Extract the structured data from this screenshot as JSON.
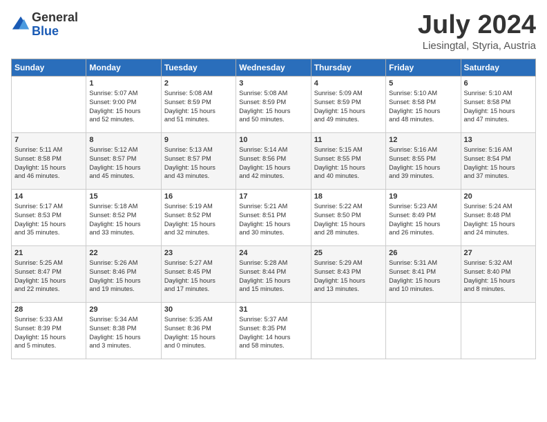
{
  "header": {
    "logo_line1": "General",
    "logo_line2": "Blue",
    "month": "July 2024",
    "location": "Liesingtal, Styria, Austria"
  },
  "weekdays": [
    "Sunday",
    "Monday",
    "Tuesday",
    "Wednesday",
    "Thursday",
    "Friday",
    "Saturday"
  ],
  "weeks": [
    [
      {
        "day": "",
        "sunrise": "",
        "sunset": "",
        "daylight": ""
      },
      {
        "day": "1",
        "sunrise": "Sunrise: 5:07 AM",
        "sunset": "Sunset: 9:00 PM",
        "daylight": "Daylight: 15 hours and 52 minutes."
      },
      {
        "day": "2",
        "sunrise": "Sunrise: 5:08 AM",
        "sunset": "Sunset: 8:59 PM",
        "daylight": "Daylight: 15 hours and 51 minutes."
      },
      {
        "day": "3",
        "sunrise": "Sunrise: 5:08 AM",
        "sunset": "Sunset: 8:59 PM",
        "daylight": "Daylight: 15 hours and 50 minutes."
      },
      {
        "day": "4",
        "sunrise": "Sunrise: 5:09 AM",
        "sunset": "Sunset: 8:59 PM",
        "daylight": "Daylight: 15 hours and 49 minutes."
      },
      {
        "day": "5",
        "sunrise": "Sunrise: 5:10 AM",
        "sunset": "Sunset: 8:58 PM",
        "daylight": "Daylight: 15 hours and 48 minutes."
      },
      {
        "day": "6",
        "sunrise": "Sunrise: 5:10 AM",
        "sunset": "Sunset: 8:58 PM",
        "daylight": "Daylight: 15 hours and 47 minutes."
      }
    ],
    [
      {
        "day": "7",
        "sunrise": "Sunrise: 5:11 AM",
        "sunset": "Sunset: 8:58 PM",
        "daylight": "Daylight: 15 hours and 46 minutes."
      },
      {
        "day": "8",
        "sunrise": "Sunrise: 5:12 AM",
        "sunset": "Sunset: 8:57 PM",
        "daylight": "Daylight: 15 hours and 45 minutes."
      },
      {
        "day": "9",
        "sunrise": "Sunrise: 5:13 AM",
        "sunset": "Sunset: 8:57 PM",
        "daylight": "Daylight: 15 hours and 43 minutes."
      },
      {
        "day": "10",
        "sunrise": "Sunrise: 5:14 AM",
        "sunset": "Sunset: 8:56 PM",
        "daylight": "Daylight: 15 hours and 42 minutes."
      },
      {
        "day": "11",
        "sunrise": "Sunrise: 5:15 AM",
        "sunset": "Sunset: 8:55 PM",
        "daylight": "Daylight: 15 hours and 40 minutes."
      },
      {
        "day": "12",
        "sunrise": "Sunrise: 5:16 AM",
        "sunset": "Sunset: 8:55 PM",
        "daylight": "Daylight: 15 hours and 39 minutes."
      },
      {
        "day": "13",
        "sunrise": "Sunrise: 5:16 AM",
        "sunset": "Sunset: 8:54 PM",
        "daylight": "Daylight: 15 hours and 37 minutes."
      }
    ],
    [
      {
        "day": "14",
        "sunrise": "Sunrise: 5:17 AM",
        "sunset": "Sunset: 8:53 PM",
        "daylight": "Daylight: 15 hours and 35 minutes."
      },
      {
        "day": "15",
        "sunrise": "Sunrise: 5:18 AM",
        "sunset": "Sunset: 8:52 PM",
        "daylight": "Daylight: 15 hours and 33 minutes."
      },
      {
        "day": "16",
        "sunrise": "Sunrise: 5:19 AM",
        "sunset": "Sunset: 8:52 PM",
        "daylight": "Daylight: 15 hours and 32 minutes."
      },
      {
        "day": "17",
        "sunrise": "Sunrise: 5:21 AM",
        "sunset": "Sunset: 8:51 PM",
        "daylight": "Daylight: 15 hours and 30 minutes."
      },
      {
        "day": "18",
        "sunrise": "Sunrise: 5:22 AM",
        "sunset": "Sunset: 8:50 PM",
        "daylight": "Daylight: 15 hours and 28 minutes."
      },
      {
        "day": "19",
        "sunrise": "Sunrise: 5:23 AM",
        "sunset": "Sunset: 8:49 PM",
        "daylight": "Daylight: 15 hours and 26 minutes."
      },
      {
        "day": "20",
        "sunrise": "Sunrise: 5:24 AM",
        "sunset": "Sunset: 8:48 PM",
        "daylight": "Daylight: 15 hours and 24 minutes."
      }
    ],
    [
      {
        "day": "21",
        "sunrise": "Sunrise: 5:25 AM",
        "sunset": "Sunset: 8:47 PM",
        "daylight": "Daylight: 15 hours and 22 minutes."
      },
      {
        "day": "22",
        "sunrise": "Sunrise: 5:26 AM",
        "sunset": "Sunset: 8:46 PM",
        "daylight": "Daylight: 15 hours and 19 minutes."
      },
      {
        "day": "23",
        "sunrise": "Sunrise: 5:27 AM",
        "sunset": "Sunset: 8:45 PM",
        "daylight": "Daylight: 15 hours and 17 minutes."
      },
      {
        "day": "24",
        "sunrise": "Sunrise: 5:28 AM",
        "sunset": "Sunset: 8:44 PM",
        "daylight": "Daylight: 15 hours and 15 minutes."
      },
      {
        "day": "25",
        "sunrise": "Sunrise: 5:29 AM",
        "sunset": "Sunset: 8:43 PM",
        "daylight": "Daylight: 15 hours and 13 minutes."
      },
      {
        "day": "26",
        "sunrise": "Sunrise: 5:31 AM",
        "sunset": "Sunset: 8:41 PM",
        "daylight": "Daylight: 15 hours and 10 minutes."
      },
      {
        "day": "27",
        "sunrise": "Sunrise: 5:32 AM",
        "sunset": "Sunset: 8:40 PM",
        "daylight": "Daylight: 15 hours and 8 minutes."
      }
    ],
    [
      {
        "day": "28",
        "sunrise": "Sunrise: 5:33 AM",
        "sunset": "Sunset: 8:39 PM",
        "daylight": "Daylight: 15 hours and 5 minutes."
      },
      {
        "day": "29",
        "sunrise": "Sunrise: 5:34 AM",
        "sunset": "Sunset: 8:38 PM",
        "daylight": "Daylight: 15 hours and 3 minutes."
      },
      {
        "day": "30",
        "sunrise": "Sunrise: 5:35 AM",
        "sunset": "Sunset: 8:36 PM",
        "daylight": "Daylight: 15 hours and 0 minutes."
      },
      {
        "day": "31",
        "sunrise": "Sunrise: 5:37 AM",
        "sunset": "Sunset: 8:35 PM",
        "daylight": "Daylight: 14 hours and 58 minutes."
      },
      {
        "day": "",
        "sunrise": "",
        "sunset": "",
        "daylight": ""
      },
      {
        "day": "",
        "sunrise": "",
        "sunset": "",
        "daylight": ""
      },
      {
        "day": "",
        "sunrise": "",
        "sunset": "",
        "daylight": ""
      }
    ]
  ]
}
